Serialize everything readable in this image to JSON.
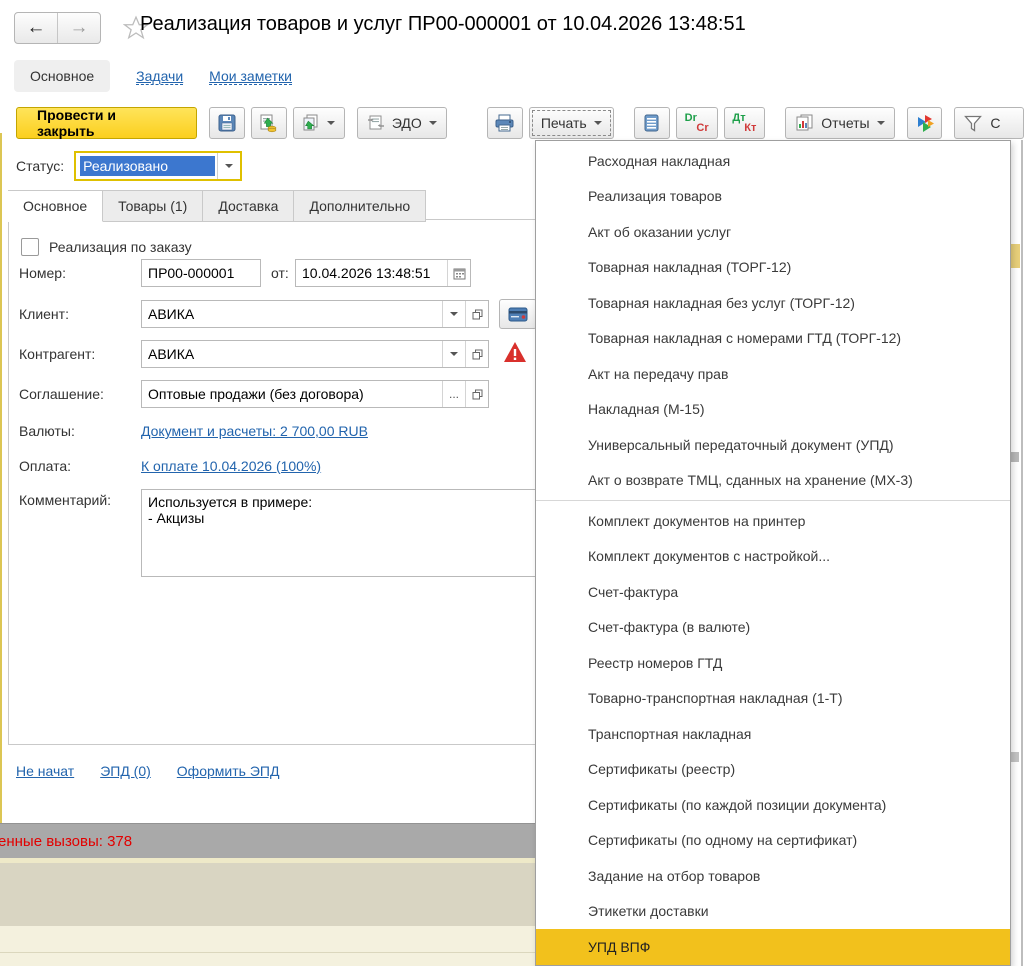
{
  "window": {
    "title": "Реализация товаров и услуг ПР00-000001 от 10.04.2026 13:48:51",
    "nav_tabs": [
      {
        "label": "Основное",
        "active": true
      },
      {
        "label": "Задачи",
        "link": true
      },
      {
        "label": "Мои заметки",
        "link": true
      }
    ]
  },
  "toolbar": {
    "post_close_label": "Провести и закрыть",
    "edo_label": "ЭДО",
    "print_label": "Печать",
    "reports_label": "Отчеты",
    "drcr": {
      "top": "Dr",
      "bottom": "Cr"
    },
    "dtkt": {
      "top": "Дт",
      "bottom": "Кт"
    },
    "extra_label": "С"
  },
  "status": {
    "label": "Статус:",
    "value": "Реализовано"
  },
  "form": {
    "tabs": [
      {
        "label": "Основное",
        "active": true
      },
      {
        "label": "Товары (1)"
      },
      {
        "label": "Доставка"
      },
      {
        "label": "Дополнительно"
      }
    ],
    "order_checkbox_label": "Реализация по заказу",
    "number_label": "Номер:",
    "number_value": "ПР00-000001",
    "date_label": "от:",
    "date_value": "10.04.2026 13:48:51",
    "client_label": "Клиент:",
    "client_value": "АВИКА",
    "counterparty_label": "Контрагент:",
    "counterparty_value": "АВИКА",
    "agreement_label": "Соглашение:",
    "agreement_value": "Оптовые продажи (без договора)",
    "agreement_more": "...",
    "currencies_label": "Валюты:",
    "currencies_link": "Документ и расчеты: 2 700,00 RUB",
    "payment_label": "Оплата:",
    "payment_link": "К оплате 10.04.2026 (100%)",
    "comment_label": "Комментарий:",
    "comment_value": "Используется в примере:\n- Акцизы",
    "footer_links": [
      "Не начат",
      "ЭПД (0)",
      "Оформить ЭПД"
    ]
  },
  "statusbar": {
    "text": "енные вызовы: 378"
  },
  "print_menu": {
    "group1": [
      {
        "label": "Расходная накладная"
      },
      {
        "label": "Реализация товаров"
      },
      {
        "label": "Акт об оказании услуг"
      },
      {
        "label": "Товарная накладная (ТОРГ-12)"
      },
      {
        "label": "Товарная накладная без услуг (ТОРГ-12)"
      },
      {
        "label": "Товарная накладная с номерами ГТД (ТОРГ-12)"
      },
      {
        "label": "Акт на передачу прав"
      },
      {
        "label": "Накладная (М-15)"
      },
      {
        "label": "Универсальный передаточный документ (УПД)"
      },
      {
        "label": "Акт о возврате ТМЦ, сданных на хранение (МХ-3)"
      }
    ],
    "group2": [
      {
        "label": "Комплект документов на принтер"
      },
      {
        "label": "Комплект документов с настройкой..."
      },
      {
        "label": "Счет-фактура"
      },
      {
        "label": "Счет-фактура (в валюте)"
      },
      {
        "label": "Реестр номеров ГТД"
      },
      {
        "label": "Товарно-транспортная накладная (1-Т)"
      },
      {
        "label": "Транспортная накладная"
      },
      {
        "label": "Сертификаты (реестр)"
      },
      {
        "label": "Сертификаты (по каждой позиции документа)"
      },
      {
        "label": "Сертификаты (по одному на сертификат)"
      },
      {
        "label": "Задание на отбор товаров"
      },
      {
        "label": "Этикетки доставки"
      },
      {
        "label": "УПД ВПФ",
        "hl": true
      }
    ]
  },
  "colors": {
    "primary_button": "#fbcf1e",
    "menu_highlight": "#f2c11c",
    "link_blue": "#2264ad",
    "selection_blue": "#3c77cf",
    "required_border": "#dfc000",
    "error_red": "#d9302c",
    "statusbar_red": "#e20000"
  }
}
